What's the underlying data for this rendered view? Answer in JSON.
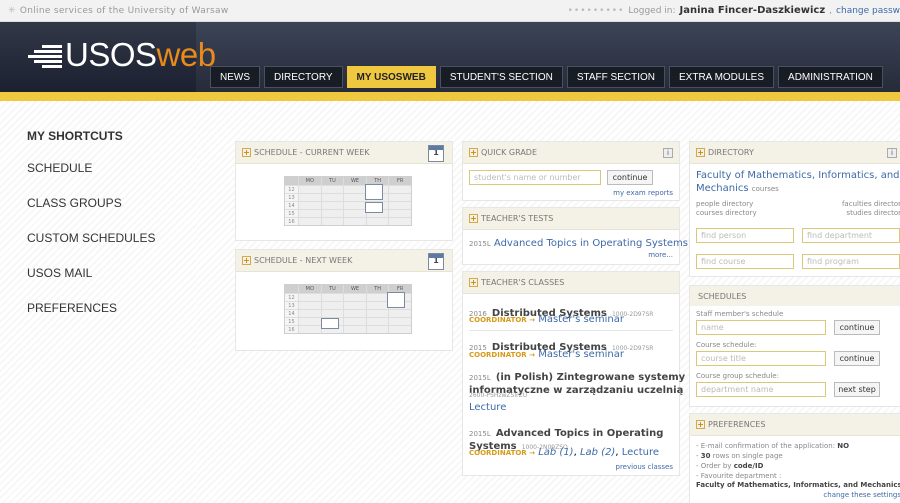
{
  "topbar": {
    "site": "Online services of the University of Warsaw",
    "dots": "•••••••••",
    "logged_in": "Logged in:",
    "user": "Janina Fincer-Daszkiewicz",
    "change_password": "change passw"
  },
  "logo": {
    "usos": "USOS",
    "web": "web"
  },
  "nav": {
    "tabs": [
      "NEWS",
      "DIRECTORY",
      "MY USOSWEB",
      "STUDENT'S SECTION",
      "STAFF SECTION",
      "EXTRA MODULES",
      "ADMINISTRATION"
    ],
    "active": "MY USOSWEB"
  },
  "sidebar": {
    "items": [
      "MY SHORTCUTS",
      "SCHEDULE",
      "CLASS GROUPS",
      "CUSTOM SCHEDULES",
      "USOS MAIL",
      "PREFERENCES"
    ]
  },
  "schedule_current": {
    "title": "SCHEDULE - CURRENT WEEK",
    "cal": "1",
    "days": [
      "MO",
      "TU",
      "WE",
      "TH",
      "FR"
    ],
    "hours": [
      "12",
      "13",
      "14",
      "15",
      "16"
    ]
  },
  "schedule_next": {
    "title": "SCHEDULE - NEXT WEEK",
    "cal": "1",
    "days": [
      "MO",
      "TU",
      "WE",
      "TH",
      "FR"
    ],
    "hours": [
      "12",
      "13",
      "14",
      "15",
      "16"
    ]
  },
  "quick_grade": {
    "title": "QUICK GRADE",
    "info": "i",
    "placeholder": "student's name or number",
    "continue": "continue",
    "exam_reports": "my exam reports"
  },
  "teachers_tests": {
    "title": "TEACHER'S TESTS",
    "code": "2015L",
    "name": "Advanced Topics in Operating Systems",
    "more": "more..."
  },
  "teachers_classes": {
    "title": "TEACHER'S CLASSES",
    "items": [
      {
        "term": "2016",
        "name": "Distributed Systems",
        "code": "1000-2D97SR",
        "coordinator": "COORDINATOR →",
        "link": "Master's seminar"
      },
      {
        "term": "2015",
        "name": "Distributed Systems",
        "code": "1000-2D97SR",
        "coordinator": "COORDINATOR →",
        "link": "Master's seminar"
      },
      {
        "term": "2015L",
        "name": "(in Polish) Zintegrowane systemy",
        "name2": "informatyczne w zarządzaniu uczelnią",
        "code": "2600-PSHzwZSIrZU",
        "link": "Lecture"
      },
      {
        "term": "2015L",
        "name": "Advanced Topics in Operating",
        "name2": "Systems",
        "code": "1000-2N09ZSO",
        "coordinator": "COORDINATOR →",
        "lab1": "Lab (1)",
        "lab2": "Lab (2)",
        "lecture": "Lecture"
      }
    ],
    "previous": "previous classes"
  },
  "directory": {
    "title": "DIRECTORY",
    "info": "i",
    "faculty": "Faculty of Mathematics, Informatics, and",
    "faculty2": "Mechanics",
    "courses": "courses",
    "people": "people directory",
    "courses_dir": "courses directory",
    "faculties": "faculties director",
    "studies": "studies director",
    "find_person": "find person",
    "find_department": "find department",
    "find_course": "find course",
    "find_program": "find program"
  },
  "schedules": {
    "title": "SCHEDULES",
    "staff_label": "Staff member's schedule",
    "staff_ph": "name",
    "continue": "continue",
    "course_label": "Course schedule:",
    "course_ph": "course title",
    "group_label": "Course group schedule:",
    "group_ph": "department name",
    "next_step": "next step"
  },
  "preferences": {
    "title": "PREFERENCES",
    "line1": "- E-mail confirmation of the application:",
    "line1v": "NO",
    "line2a": "- ",
    "line2b": "30",
    "line2c": " rows on single page",
    "line3a": "- Order by ",
    "line3b": "code/ID",
    "line4": "- Favourite department :",
    "line5": "Faculty of Mathematics, Informatics, and Mechanics",
    "change": "change these settings"
  }
}
